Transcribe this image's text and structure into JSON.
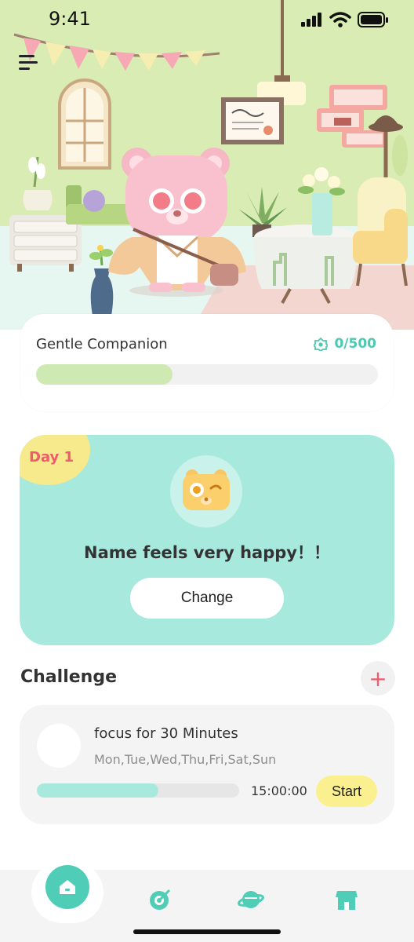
{
  "status_bar": {
    "time": "9:41"
  },
  "companion": {
    "label": "Gentle Companion",
    "score": "0/500",
    "progress_fraction": 0.4
  },
  "day_card": {
    "day": "Day 1",
    "message": "Name feels very happy！！",
    "button": "Change"
  },
  "challenge": {
    "title": "Challenge",
    "add_symbol": "+",
    "task": {
      "title": "focus for 30 Minutes",
      "days": "Mon,Tue,Wed,Thu,Fri,Sat,Sun",
      "time": "15:00:00",
      "progress_fraction": 0.6,
      "start": "Start"
    }
  },
  "tabs": [
    {
      "icon": "home-icon",
      "active": true
    },
    {
      "icon": "target-icon",
      "active": false
    },
    {
      "icon": "planet-icon",
      "active": false
    },
    {
      "icon": "shop-icon",
      "active": false
    }
  ],
  "colors": {
    "accent": "#4fcdb7",
    "hero_background": "#d9ecb3",
    "day_card": "#a8e9dd",
    "day_badge": "#f7ea8c",
    "start_button": "#fbf08f",
    "companion_bar": "#cfe9b3"
  }
}
